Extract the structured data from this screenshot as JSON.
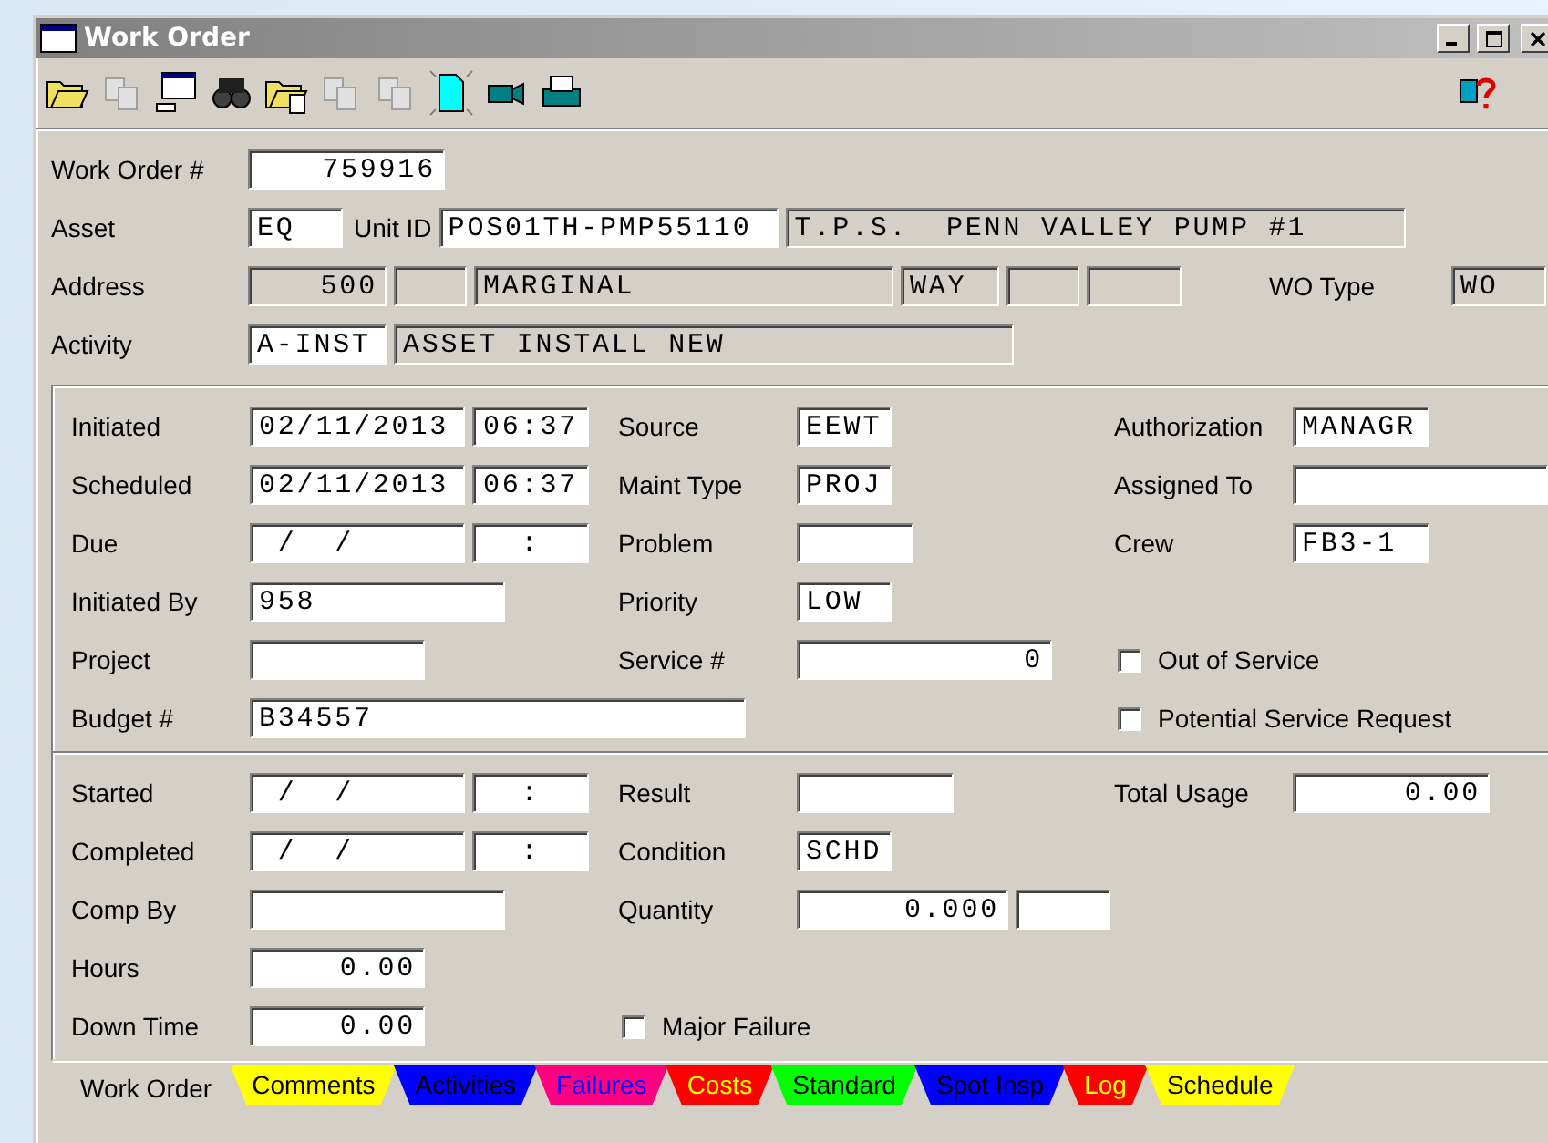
{
  "window": {
    "title": "Work Order"
  },
  "toolbar": [
    {
      "kind": "open",
      "disabled": false
    },
    {
      "kind": "copy-list",
      "disabled": true
    },
    {
      "kind": "screen",
      "disabled": false
    },
    {
      "kind": "find",
      "disabled": false
    },
    {
      "kind": "folder-doc",
      "disabled": false
    },
    {
      "kind": "add-copy",
      "disabled": true
    },
    {
      "kind": "split",
      "disabled": true
    },
    {
      "kind": "new",
      "disabled": false
    },
    {
      "kind": "camera",
      "disabled": false
    },
    {
      "kind": "print",
      "disabled": false
    }
  ],
  "header": [
    {
      "label": "Work Order #",
      "items": [
        {
          "kind": "number",
          "value": "759916",
          "disabled": false
        }
      ]
    },
    {
      "label": "Asset",
      "items": [
        {
          "kind": "code",
          "value": "EQ",
          "disabled": false
        },
        {
          "kind": "label",
          "text": "Unit ID"
        },
        {
          "kind": "unit",
          "value": "POS01TH-PMP55110",
          "disabled": false
        },
        {
          "kind": "desc",
          "value": "T.P.S.  PENN VALLEY PUMP #1",
          "disabled": true
        }
      ]
    },
    {
      "label": "Address",
      "items": [
        {
          "kind": "house",
          "value": "500",
          "disabled": true
        },
        {
          "kind": "tiny",
          "disabled": true
        },
        {
          "kind": "street",
          "value": "MARGINAL",
          "disabled": true
        },
        {
          "kind": "suffix",
          "value": "WAY",
          "disabled": true
        },
        {
          "kind": "tiny",
          "disabled": true
        },
        {
          "kind": "small",
          "disabled": true
        },
        {
          "kind": "far-label",
          "text": "WO Type"
        },
        {
          "kind": "code",
          "value": "WO",
          "disabled": true
        }
      ]
    },
    {
      "label": "Activity",
      "items": [
        {
          "kind": "activity",
          "value": "A-INST",
          "disabled": false
        },
        {
          "kind": "desc",
          "value": "ASSET INSTALL NEW",
          "disabled": true
        }
      ]
    }
  ],
  "panels": [
    {
      "rows": [
        {
          "col1": {
            "kind": "fields",
            "label": "Initiated",
            "fields": [
              {
                "kind": "date",
                "value": "02/11/2013",
                "disabled": false
              },
              {
                "kind": "time",
                "value": "06:37",
                "disabled": false
              }
            ]
          },
          "col2": {
            "kind": "fields",
            "label": "Source",
            "fields": [
              {
                "kind": "code",
                "value": "EEWT",
                "disabled": false
              }
            ]
          },
          "col3": {
            "kind": "fields",
            "label": "Authorization",
            "fields": [
              {
                "kind": "codewide",
                "value": "MANAGR",
                "disabled": false
              }
            ]
          }
        },
        {
          "col1": {
            "kind": "fields",
            "label": "Scheduled",
            "fields": [
              {
                "kind": "date",
                "value": "02/11/2013",
                "disabled": false
              },
              {
                "kind": "time",
                "value": "06:37",
                "disabled": false
              }
            ]
          },
          "col2": {
            "kind": "fields",
            "label": "Maint Type",
            "fields": [
              {
                "kind": "code",
                "value": "PROJ",
                "disabled": false
              }
            ]
          },
          "col3": {
            "kind": "fields",
            "label": "Assigned To",
            "fields": [
              {
                "kind": "name",
                "disabled": false
              }
            ]
          }
        },
        {
          "col1": {
            "kind": "fields",
            "label": "Due",
            "fields": [
              {
                "kind": "date",
                "value": " /  /",
                "disabled": false
              },
              {
                "kind": "time",
                "value": ":",
                "disabled": false
              }
            ]
          },
          "col2": {
            "kind": "fields",
            "label": "Problem",
            "fields": [
              {
                "kind": "problem",
                "disabled": false
              }
            ]
          },
          "col3": {
            "kind": "fields",
            "label": "Crew",
            "fields": [
              {
                "kind": "codewide",
                "value": "FB3-1",
                "disabled": false
              }
            ]
          }
        },
        {
          "col1": {
            "kind": "fields",
            "label": "Initiated By",
            "fields": [
              {
                "kind": "name",
                "value": "958",
                "disabled": false
              }
            ]
          },
          "col2": {
            "kind": "fields",
            "label": "Priority",
            "fields": [
              {
                "kind": "code",
                "value": "LOW",
                "disabled": false
              }
            ]
          }
        },
        {
          "col1": {
            "kind": "fields",
            "label": "Project",
            "fields": [
              {
                "kind": "project",
                "disabled": false
              }
            ]
          },
          "col2": {
            "kind": "fields",
            "label": "Service #",
            "fields": [
              {
                "kind": "service",
                "value": "0",
                "disabled": false
              }
            ]
          },
          "col3": {
            "kind": "checkbox",
            "label": "Out of Service",
            "checked": false
          }
        },
        {
          "col1": {
            "kind": "fields",
            "label": "Budget #",
            "fields": [
              {
                "kind": "budget",
                "value": "B34557",
                "disabled": false
              }
            ]
          },
          "col3": {
            "kind": "checkbox",
            "label": "Potential Service Request",
            "checked": false
          }
        }
      ]
    },
    {
      "rows": [
        {
          "col1": {
            "kind": "fields",
            "label": "Started",
            "fields": [
              {
                "kind": "date",
                "value": " /  /",
                "disabled": false
              },
              {
                "kind": "time",
                "value": ":",
                "disabled": false
              }
            ]
          },
          "col2": {
            "kind": "fields",
            "label": "Result",
            "fields": [
              {
                "kind": "result",
                "disabled": false
              }
            ]
          },
          "col3": {
            "kind": "fields",
            "label": "Total Usage",
            "fields": [
              {
                "kind": "number",
                "value": "0.00",
                "disabled": false
              }
            ]
          }
        },
        {
          "col1": {
            "kind": "fields",
            "label": "Completed",
            "fields": [
              {
                "kind": "date",
                "value": " /  /",
                "disabled": false
              },
              {
                "kind": "time",
                "value": ":",
                "disabled": false
              }
            ]
          },
          "col2": {
            "kind": "fields",
            "label": "Condition",
            "fields": [
              {
                "kind": "code",
                "value": "SCHD",
                "disabled": false
              }
            ]
          }
        },
        {
          "col1": {
            "kind": "fields",
            "label": "Comp By",
            "fields": [
              {
                "kind": "name",
                "disabled": false
              }
            ]
          },
          "col2": {
            "kind": "fields",
            "label": "Quantity",
            "fields": [
              {
                "kind": "qty",
                "value": "0.000",
                "disabled": false
              },
              {
                "kind": "small",
                "disabled": false
              }
            ]
          }
        },
        {
          "col1": {
            "kind": "fields",
            "label": "Hours",
            "fields": [
              {
                "kind": "hours",
                "value": "0.00",
                "disabled": false
              }
            ]
          }
        },
        {
          "col1": {
            "kind": "fields",
            "label": "Down Time",
            "fields": [
              {
                "kind": "hours",
                "value": "0.00",
                "disabled": false
              }
            ]
          },
          "col2": {
            "kind": "checkbox",
            "label": "Major Failure",
            "checked": false
          }
        }
      ]
    }
  ],
  "tabs": [
    {
      "label": "Work Order",
      "selected": true,
      "color": "#d4d0c8",
      "kind": "dark"
    },
    {
      "label": "Comments",
      "selected": false,
      "color": "#ffff00",
      "kind": "dark"
    },
    {
      "label": "Activities",
      "selected": false,
      "color": "#0000ff",
      "kind": "dark"
    },
    {
      "label": "Failures",
      "selected": false,
      "color": "#ff0080",
      "kind": "link"
    },
    {
      "label": "Costs",
      "selected": false,
      "color": "#ff0000",
      "kind": "bright"
    },
    {
      "label": "Standard",
      "selected": false,
      "color": "#00ff00",
      "kind": "dark"
    },
    {
      "label": "Spot Insp",
      "selected": false,
      "color": "#0000ff",
      "kind": "dark"
    },
    {
      "label": "Log",
      "selected": false,
      "color": "#ff0000",
      "kind": "bright"
    },
    {
      "label": "Schedule",
      "selected": false,
      "color": "#ffff00",
      "kind": "dark"
    }
  ]
}
